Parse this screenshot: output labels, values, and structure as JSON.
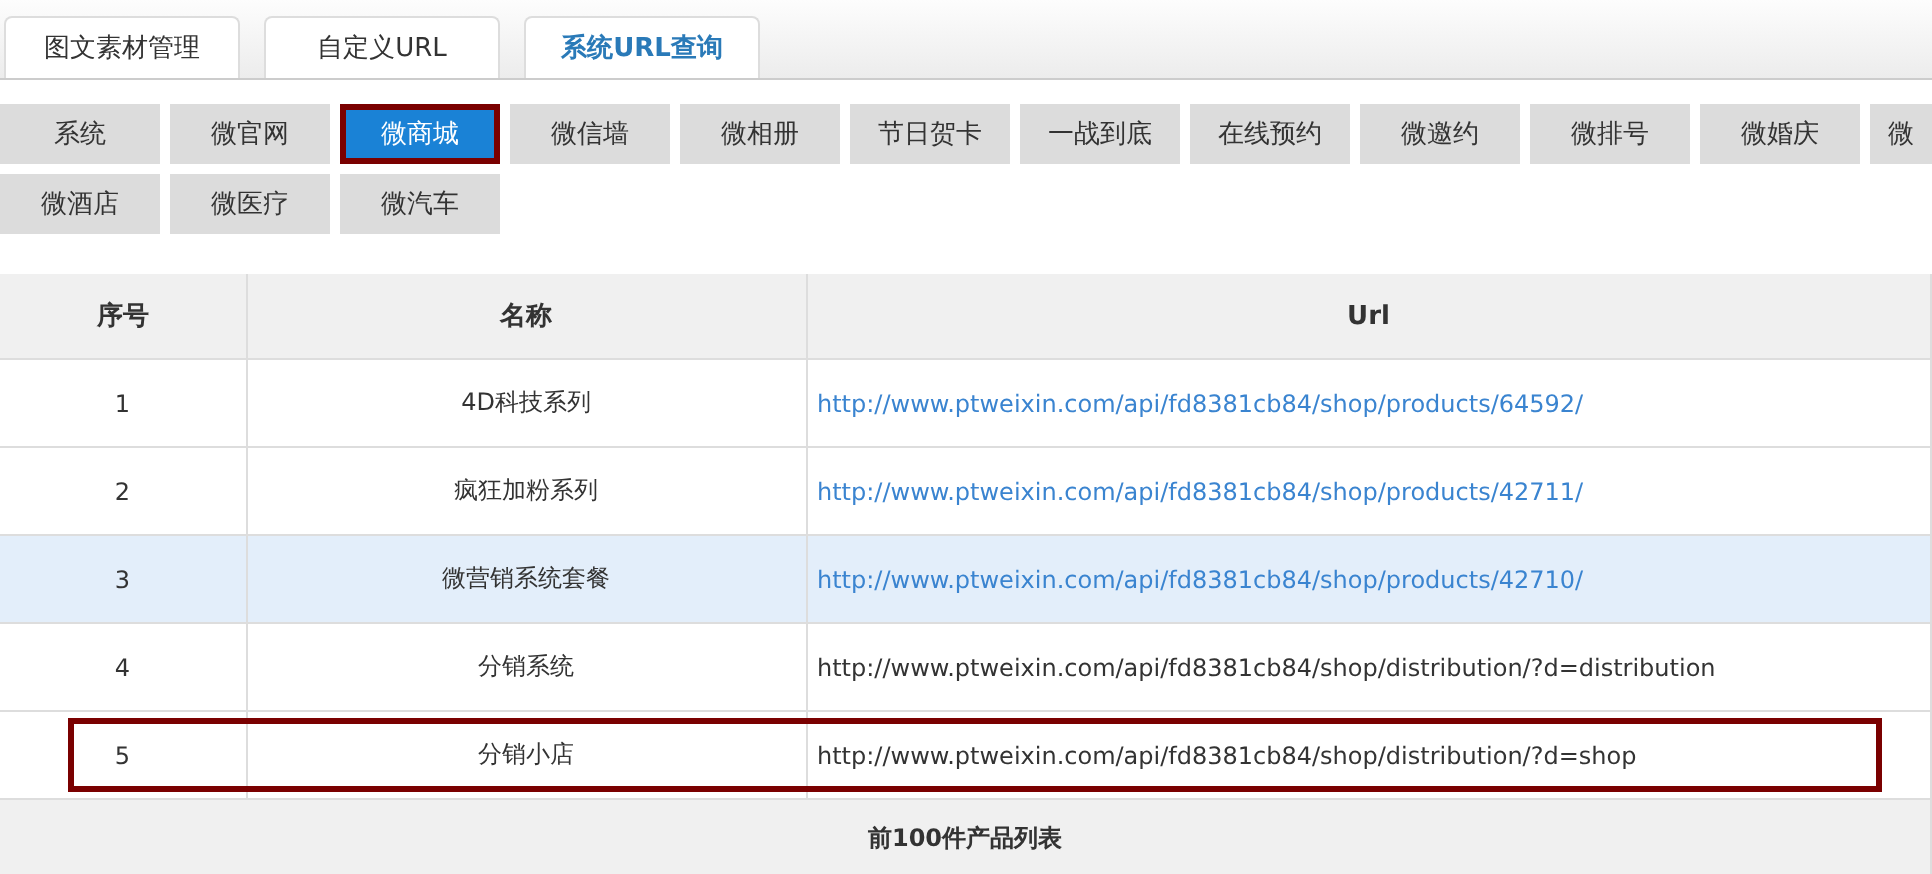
{
  "tabs": [
    {
      "label": "图文素材管理",
      "selected": false
    },
    {
      "label": "自定义URL",
      "selected": false
    },
    {
      "label": "系统URL查询",
      "selected": true
    }
  ],
  "category_rows": [
    [
      {
        "label": "系统",
        "selected": false
      },
      {
        "label": "微官网",
        "selected": false
      },
      {
        "label": "微商城",
        "selected": true
      },
      {
        "label": "微信墙",
        "selected": false
      },
      {
        "label": "微相册",
        "selected": false
      },
      {
        "label": "节日贺卡",
        "selected": false
      },
      {
        "label": "一战到底",
        "selected": false
      },
      {
        "label": "在线预约",
        "selected": false
      },
      {
        "label": "微邀约",
        "selected": false
      },
      {
        "label": "微排号",
        "selected": false
      },
      {
        "label": "微婚庆",
        "selected": false
      },
      {
        "label": "微",
        "selected": false
      }
    ],
    [
      {
        "label": "微酒店",
        "selected": false
      },
      {
        "label": "微医疗",
        "selected": false
      },
      {
        "label": "微汽车",
        "selected": false
      }
    ]
  ],
  "table": {
    "columns": [
      "序号",
      "名称",
      "Url"
    ],
    "rows": [
      {
        "index": "1",
        "name": "4D科技系列",
        "url": "http://www.ptweixin.com/api/fd8381cb84/shop/products/64592/",
        "kind": "link",
        "selected": false,
        "outlined": false
      },
      {
        "index": "2",
        "name": "疯狂加粉系列",
        "url": "http://www.ptweixin.com/api/fd8381cb84/shop/products/42711/",
        "kind": "link",
        "selected": false,
        "outlined": false
      },
      {
        "index": "3",
        "name": "微营销系统套餐",
        "url": "http://www.ptweixin.com/api/fd8381cb84/shop/products/42710/",
        "kind": "link",
        "selected": true,
        "outlined": false
      },
      {
        "index": "4",
        "name": "分销系统",
        "url": "http://www.ptweixin.com/api/fd8381cb84/shop/distribution/?d=distribution",
        "kind": "text",
        "selected": false,
        "outlined": false
      },
      {
        "index": "5",
        "name": "分销小店",
        "url": "http://www.ptweixin.com/api/fd8381cb84/shop/distribution/?d=shop",
        "kind": "text",
        "selected": false,
        "outlined": true
      }
    ],
    "section_header": "前100件产品列表"
  }
}
